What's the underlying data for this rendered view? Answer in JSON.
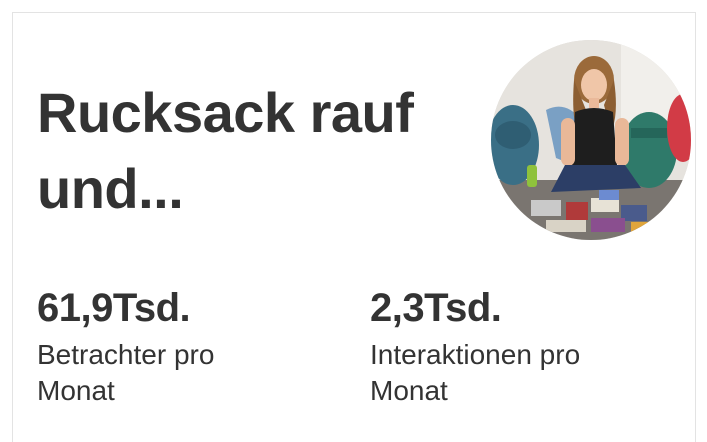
{
  "card": {
    "title": "Rucksack rauf und...",
    "stats": [
      {
        "value": "61,9Tsd.",
        "label_line1": "Betrachter pro",
        "label_line2": "Monat"
      },
      {
        "value": "2,3Tsd.",
        "label_line1": "Interaktionen pro",
        "label_line2": "Monat"
      }
    ]
  },
  "colors": {
    "text": "#333333",
    "border": "#e3e3e3",
    "background": "#ffffff"
  }
}
